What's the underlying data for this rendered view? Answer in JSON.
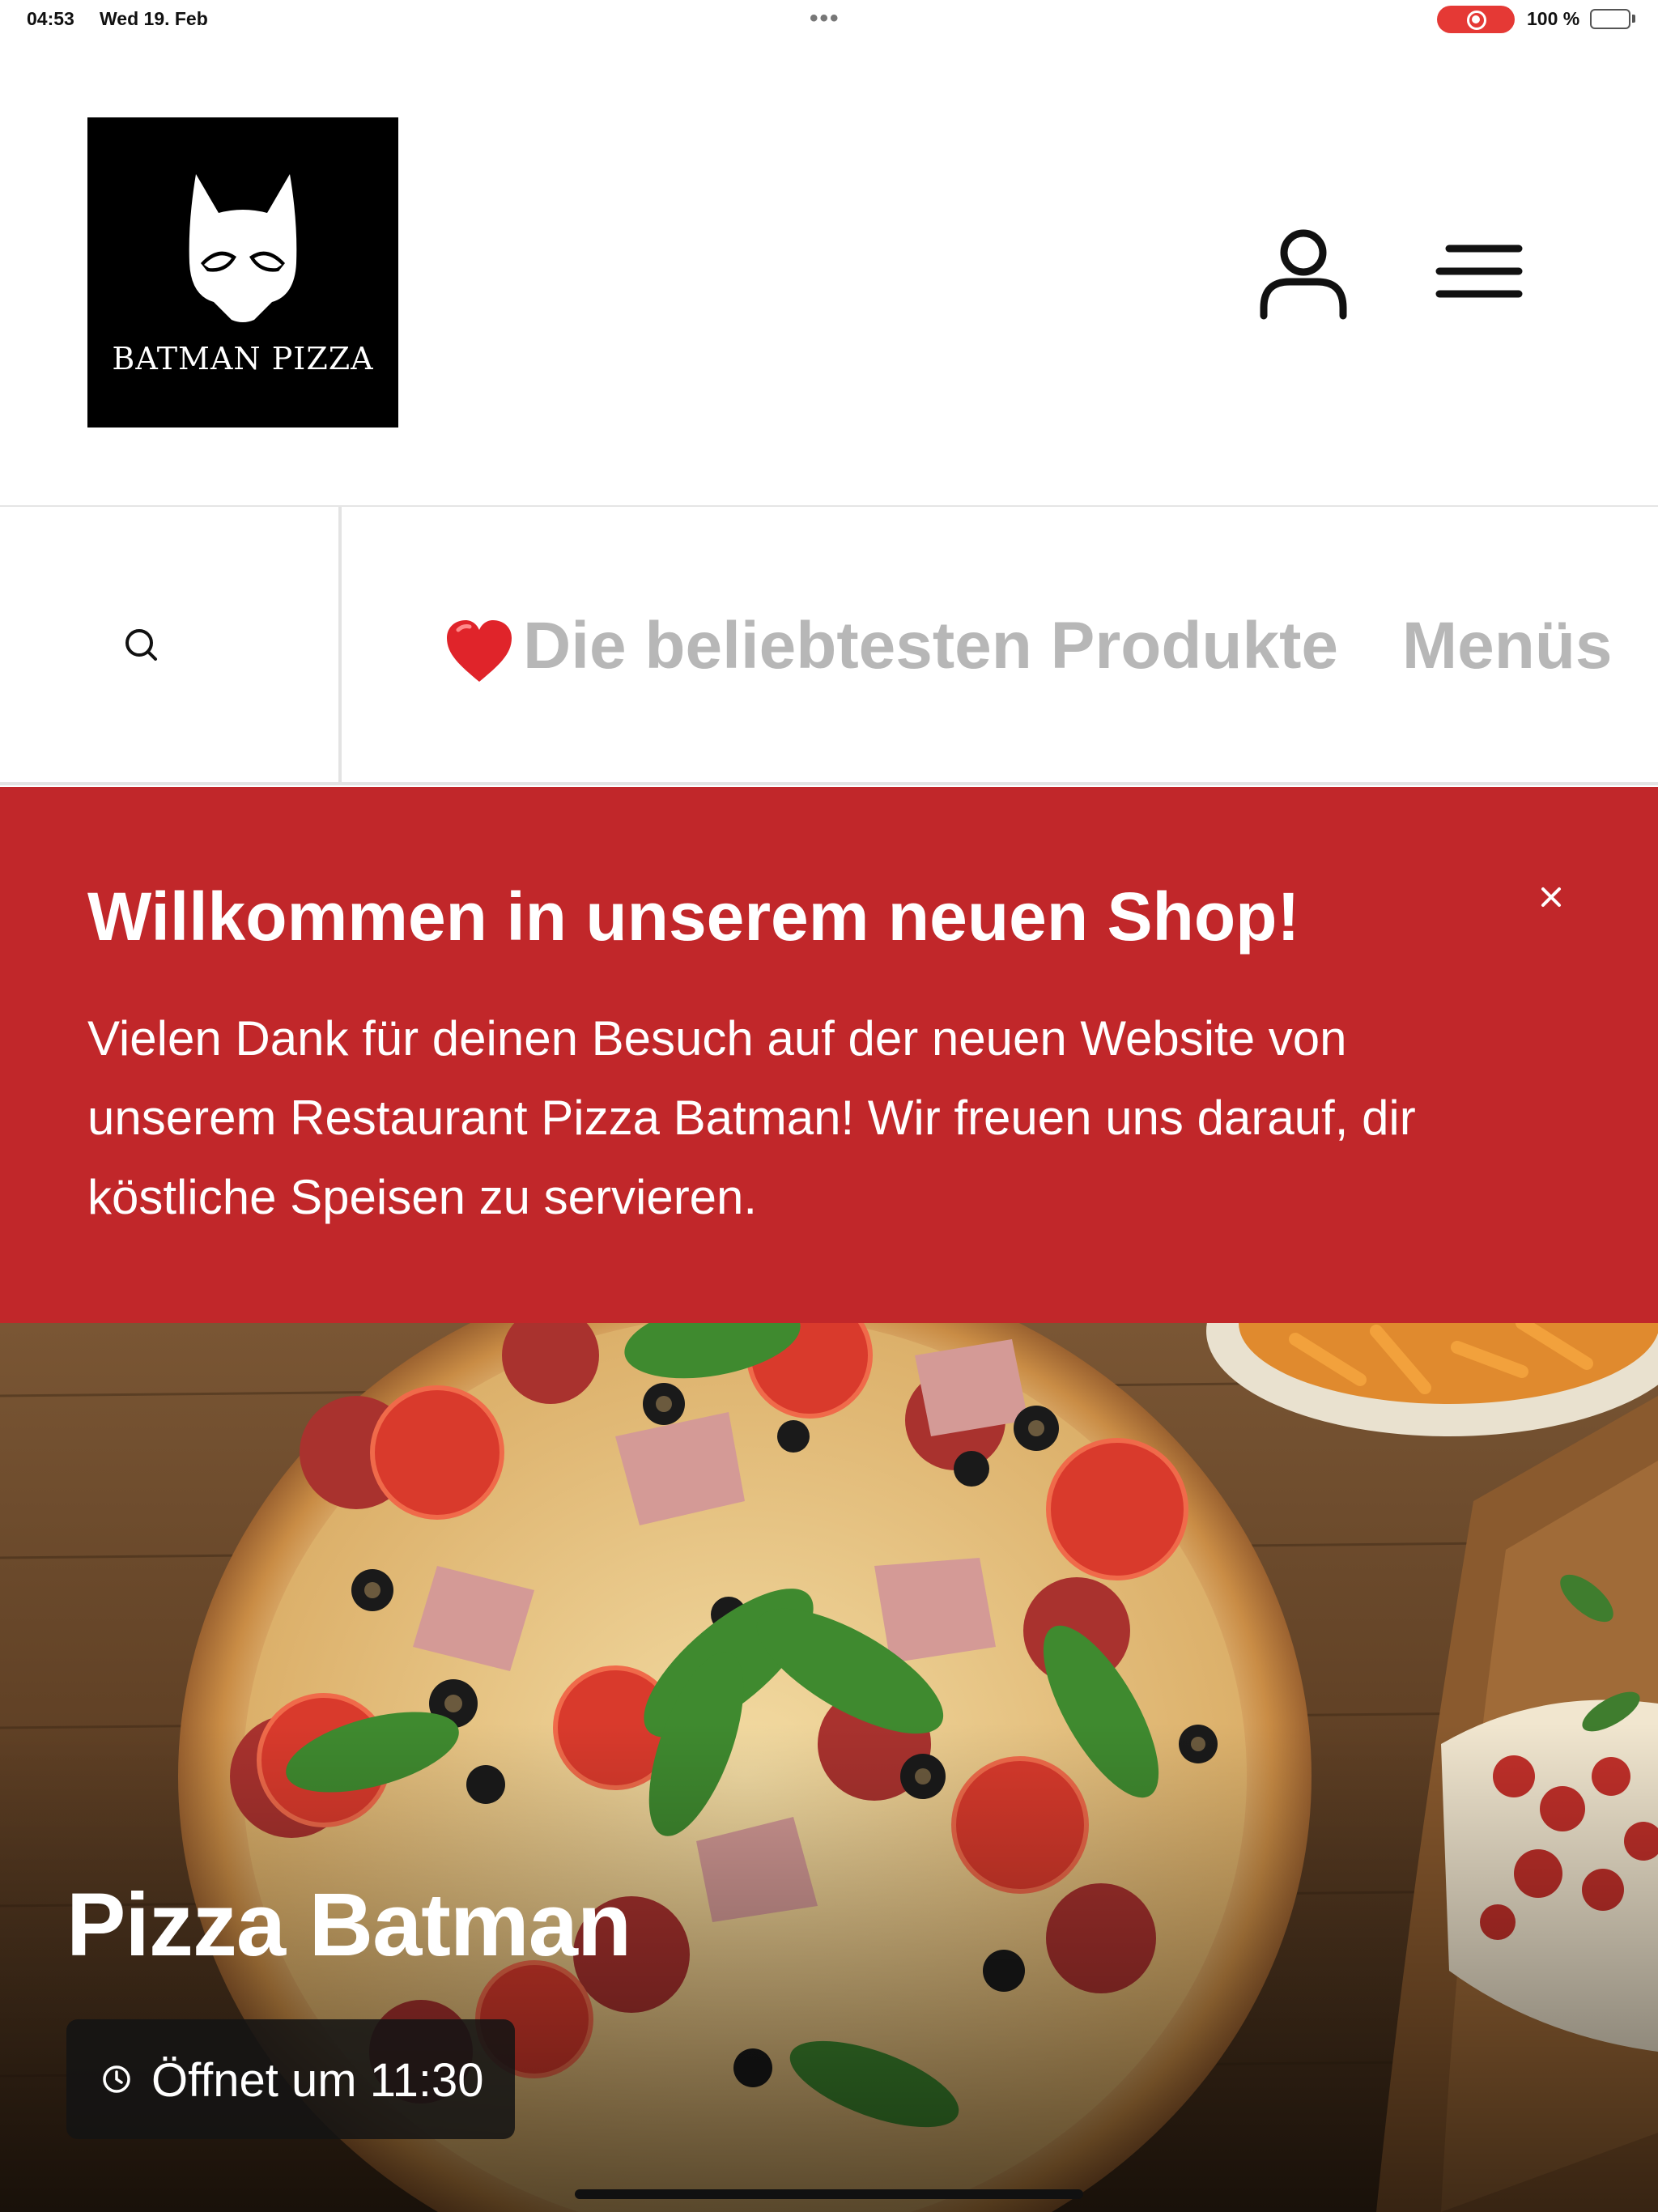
{
  "status_bar": {
    "time": "04:53",
    "date": "Wed 19. Feb",
    "battery": "100 %"
  },
  "header": {
    "logo_text": "BATMAN PIZZA",
    "account_icon": "user-icon",
    "menu_icon": "hamburger-menu-icon"
  },
  "nav": {
    "search_icon": "search-icon",
    "items": [
      {
        "label": "Die beliebtesten Produkte",
        "icon": "heart-icon"
      },
      {
        "label": "Menüs"
      }
    ]
  },
  "banner": {
    "title": "Willkommen in unserem neuen Shop!",
    "text": "Vielen Dank für deinen Besuch auf der neuen Website von unserem Restaurant Pizza Batman! Wir freuen uns darauf, dir köstliche Speisen zu servieren.",
    "close_icon": "close-icon"
  },
  "hero": {
    "title": "Pizza Batman",
    "status": "Öffnet um 11:30",
    "status_icon": "clock-icon"
  },
  "colors": {
    "banner_background": "#c1272a",
    "nav_text": "#b7b7b7",
    "logo_background": "#000000"
  }
}
